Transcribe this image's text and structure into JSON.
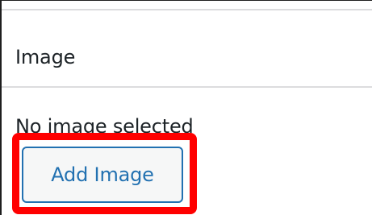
{
  "panel": {
    "section_title": "Image",
    "empty_state_text": "No image selected",
    "add_button_label": "Add Image"
  },
  "colors": {
    "accent": "#2271b1",
    "highlight": "#ff0000",
    "text": "#1d2327",
    "divider": "#dcdcde"
  }
}
